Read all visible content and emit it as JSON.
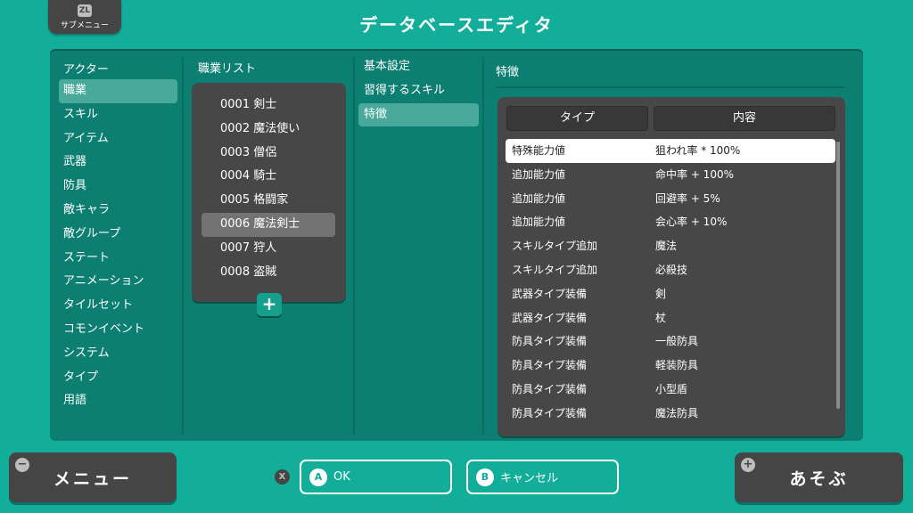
{
  "header": {
    "submenu_icon": "ZL",
    "submenu_label": "サブメニュー",
    "title": "データベースエディタ"
  },
  "categories": {
    "header": "アクター",
    "items": [
      {
        "label": "職業",
        "selected": true
      },
      {
        "label": "スキル"
      },
      {
        "label": "アイテム"
      },
      {
        "label": "武器"
      },
      {
        "label": "防具"
      },
      {
        "label": "敵キャラ"
      },
      {
        "label": "敵グループ"
      },
      {
        "label": "ステート"
      },
      {
        "label": "アニメーション"
      },
      {
        "label": "タイルセット"
      },
      {
        "label": "コモンイベント"
      },
      {
        "label": "システム"
      },
      {
        "label": "タイプ"
      },
      {
        "label": "用語"
      }
    ]
  },
  "class_list": {
    "header": "職業リスト",
    "items": [
      {
        "label": "0001 剣士"
      },
      {
        "label": "0002 魔法使い"
      },
      {
        "label": "0003 僧侶"
      },
      {
        "label": "0004 騎士"
      },
      {
        "label": "0005 格闘家"
      },
      {
        "label": "0006 魔法剣士",
        "selected": true
      },
      {
        "label": "0007 狩人"
      },
      {
        "label": "0008 盗賊"
      }
    ],
    "add_icon": "+"
  },
  "sections": {
    "items": [
      {
        "label": "基本設定"
      },
      {
        "label": "習得するスキル"
      },
      {
        "label": "特徴",
        "selected": true
      }
    ]
  },
  "traits": {
    "title": "特徴",
    "columns": {
      "type": "タイプ",
      "content": "内容"
    },
    "rows": [
      {
        "type": "特殊能力値",
        "content": "狙われ率 * 100%",
        "selected": true
      },
      {
        "type": "追加能力値",
        "content": "命中率 + 100%"
      },
      {
        "type": "追加能力値",
        "content": "回避率 + 5%"
      },
      {
        "type": "追加能力値",
        "content": "会心率 + 10%"
      },
      {
        "type": "スキルタイプ追加",
        "content": "魔法"
      },
      {
        "type": "スキルタイプ追加",
        "content": "必殺技"
      },
      {
        "type": "武器タイプ装備",
        "content": "剣"
      },
      {
        "type": "武器タイプ装備",
        "content": "杖"
      },
      {
        "type": "防具タイプ装備",
        "content": "一般防具"
      },
      {
        "type": "防具タイプ装備",
        "content": "軽装防具"
      },
      {
        "type": "防具タイプ装備",
        "content": "小型盾"
      },
      {
        "type": "防具タイプ装備",
        "content": "魔法防具"
      }
    ]
  },
  "footer": {
    "menu_label": "メニュー",
    "menu_icon": "−",
    "x_icon": "X",
    "ok_letter": "A",
    "ok_label": "OK",
    "cancel_letter": "B",
    "cancel_label": "キャンセル",
    "play_label": "あそぶ",
    "play_icon": "+"
  },
  "colors": {
    "background": "#13ae9a",
    "panel": "#0d7f72",
    "list_box": "#474747",
    "button_dark": "#454545",
    "selection_teal": "#49aa9b",
    "selection_gray": "#737373"
  }
}
